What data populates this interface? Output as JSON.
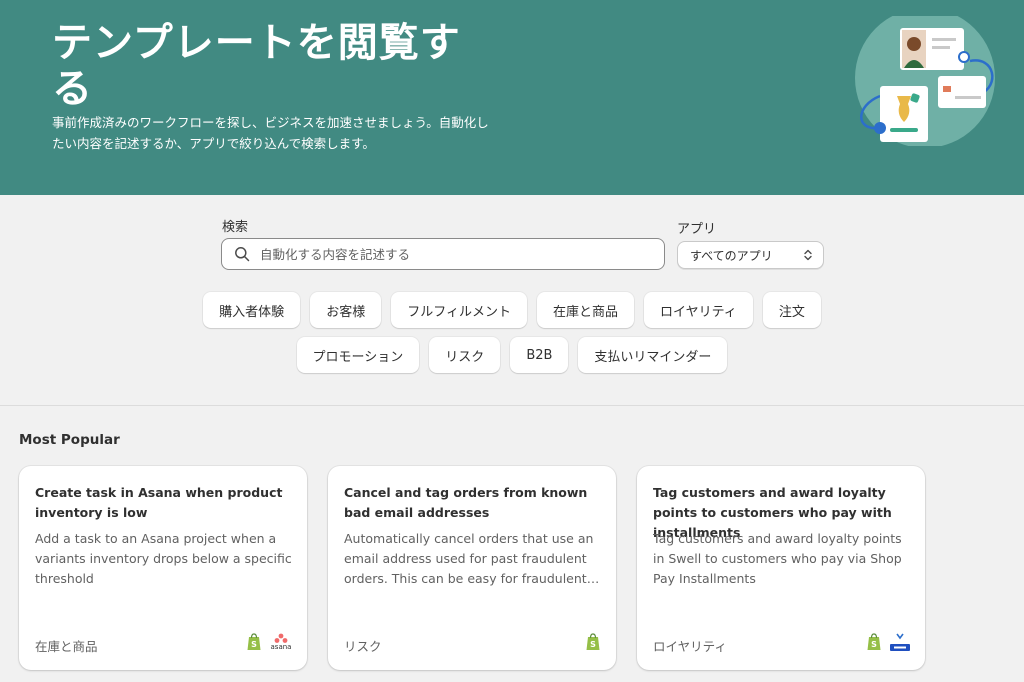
{
  "hero": {
    "title": "テンプレートを閲覧する",
    "subtitle": "事前作成済みのワークフローを探し、ビジネスを加速させましょう。自動化したい内容を記述するか、アプリで絞り込んで検索します。"
  },
  "search": {
    "label": "検索",
    "placeholder": "自動化する内容を記述する",
    "value": ""
  },
  "app_filter": {
    "label": "アプリ",
    "selected": "すべてのアプリ"
  },
  "categories_row1": [
    "購入者体験",
    "お客様",
    "フルフィルメント",
    "在庫と商品",
    "ロイヤリティ",
    "注文"
  ],
  "categories_row2": [
    "プロモーション",
    "リスク",
    "B2B",
    "支払いリマインダー"
  ],
  "section": {
    "title": "Most Popular"
  },
  "cards": [
    {
      "title": "Create task in Asana when product inventory is low",
      "description": "Add a task to an Asana project when a variants inventory drops below a specific threshold",
      "category": "在庫と商品",
      "icons": [
        "shopify-icon",
        "asana-icon"
      ],
      "asana_text": "asana"
    },
    {
      "title": "Cancel and tag orders from known bad email addresses",
      "description": "Automatically cancel orders that use an email address used for past fraudulent orders. This can be easy for fraudulent…",
      "category": "リスク",
      "icons": [
        "shopify-icon"
      ]
    },
    {
      "title": "Tag customers and award loyalty points to customers who pay with installments",
      "description": "Tag customers and award loyalty points in Swell to customers who pay via Shop Pay Installments",
      "category": "ロイヤリティ",
      "icons": [
        "shopify-icon",
        "swell-icon"
      ]
    }
  ],
  "colors": {
    "hero_bg": "#418a82",
    "page_bg": "#f1f1f1",
    "shopify_green": "#95bf47",
    "asana_red": "#f06a6a"
  }
}
